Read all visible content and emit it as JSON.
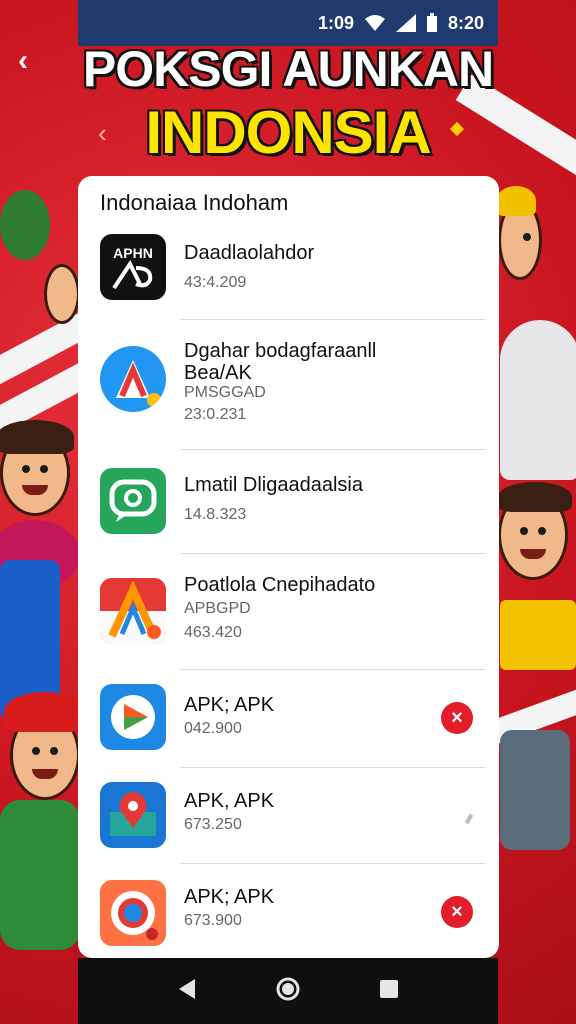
{
  "status_bar": {
    "time_left": "1:09",
    "time_right": "8:20"
  },
  "header": {
    "title_line1": "POKSGI AUNKAN",
    "title_line2": "INDONSIA"
  },
  "card": {
    "title": "Indonaiaa Indoham",
    "items": [
      {
        "name": "Daadlaolahdor",
        "meta": [
          "43:4.209"
        ],
        "icon": "aphn-app-icon"
      },
      {
        "name": "Dgahar bodagfaraanll Bea/AK",
        "meta": [
          "PMSGGAD",
          "23:0.231"
        ],
        "icon": "a-logo-app-icon"
      },
      {
        "name": "Lmatil Dligaadaalsia",
        "meta": [
          "14.8.323"
        ],
        "icon": "chat-app-icon"
      },
      {
        "name": "Poatlola Cnepihadato",
        "meta": [
          "APBGPD",
          "463.420"
        ],
        "icon": "indonesia-a-app-icon"
      },
      {
        "name": "APK; APK",
        "meta": [
          "042.900"
        ],
        "icon": "play-app-icon",
        "action": "×"
      },
      {
        "name": "APK, APK",
        "meta": [
          "673.250"
        ],
        "icon": "map-app-icon"
      },
      {
        "name": "APK; APK",
        "meta": [
          "673.900"
        ],
        "icon": "camera-app-icon",
        "action": "×"
      }
    ]
  },
  "colors": {
    "accent": "#e21e2b",
    "status_bar": "#1e3a6e",
    "title_yellow": "#ffe400"
  },
  "icons": [
    "back-arrow-icon",
    "wifi-icon",
    "signal-icon",
    "battery-icon",
    "remove-icon",
    "nav-back-icon",
    "nav-home-icon",
    "nav-recents-icon"
  ]
}
